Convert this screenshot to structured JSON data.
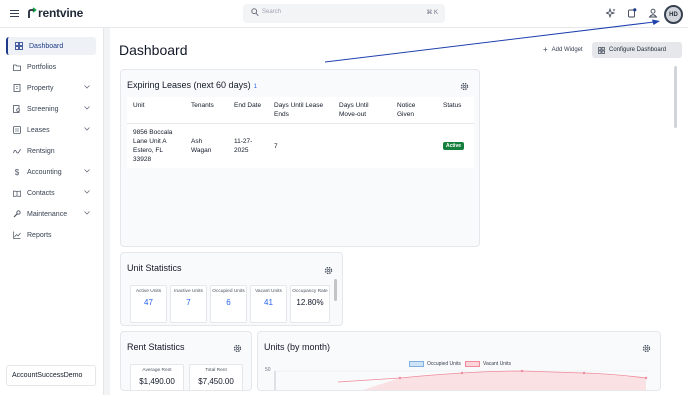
{
  "app": {
    "brand": "rentvine"
  },
  "search": {
    "placeholder": "Search",
    "shortcut": "⌘ K"
  },
  "user": {
    "initials": "HD"
  },
  "sidebar": {
    "items": [
      {
        "label": "Dashboard",
        "icon": "grid-icon",
        "active": true,
        "chevron": false
      },
      {
        "label": "Portfolios",
        "icon": "folder-icon",
        "chevron": false
      },
      {
        "label": "Property",
        "icon": "building-icon",
        "chevron": true
      },
      {
        "label": "Screening",
        "icon": "document-search-icon",
        "chevron": true
      },
      {
        "label": "Leases",
        "icon": "lease-icon",
        "chevron": true
      },
      {
        "label": "Rentsign",
        "icon": "signature-icon",
        "chevron": false
      },
      {
        "label": "Accounting",
        "icon": "dollar-icon",
        "chevron": true
      },
      {
        "label": "Contacts",
        "icon": "contacts-book-icon",
        "chevron": true
      },
      {
        "label": "Maintenance",
        "icon": "wrench-icon",
        "chevron": true
      },
      {
        "label": "Reports",
        "icon": "chart-line-icon",
        "chevron": false
      }
    ],
    "account": "AccountSuccessDemo"
  },
  "main": {
    "title": "Dashboard",
    "add_widget": "Add Widget",
    "configure": "Configure Dashboard"
  },
  "expiring_leases": {
    "title": "Expiring Leases (next 60 days)",
    "count": "1",
    "columns": [
      "Unit",
      "Tenants",
      "End Date",
      "Days Until Lease Ends",
      "Days Until Move-out",
      "Notice Given",
      "Status"
    ],
    "rows": [
      {
        "unit": "9856 Boccala Lane Unit A Estero, FL 33928",
        "tenants": "Ash Wagan",
        "end_date": "11-27-2025",
        "days_lease": "7",
        "days_move": "",
        "notice": "",
        "status": "Active"
      }
    ]
  },
  "unit_statistics": {
    "title": "Unit Statistics",
    "stats": [
      {
        "label": "Active Units",
        "value": "47"
      },
      {
        "label": "Inactive Units",
        "value": "7"
      },
      {
        "label": "Occupied Units",
        "value": "6"
      },
      {
        "label": "Vacant Units",
        "value": "41"
      },
      {
        "label": "Occupancy Rate",
        "value": "12.80%"
      }
    ]
  },
  "rent_statistics": {
    "title": "Rent Statistics",
    "stats": [
      {
        "label": "Average Rent",
        "value": "$1,490.00"
      },
      {
        "label": "Total Rent",
        "value": "$7,450.00"
      }
    ]
  },
  "units_by_month": {
    "title": "Units (by month)",
    "legend": [
      {
        "name": "Occupied Units",
        "color": "#cfe3f7",
        "border": "#7fb0e0"
      },
      {
        "name": "Vacant Units",
        "color": "#fbd5da",
        "border": "#f08a9a"
      }
    ],
    "ytick": "50"
  },
  "colors": {
    "accent": "#1e3a8a",
    "link": "#2563eb",
    "active_badge": "#15803d"
  }
}
